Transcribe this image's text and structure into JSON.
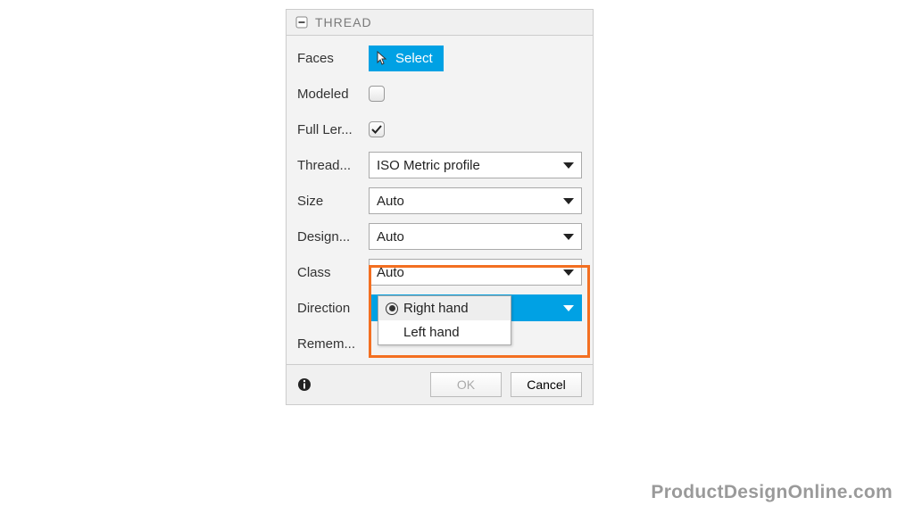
{
  "panel": {
    "title": "THREAD",
    "rows": {
      "faces": {
        "label": "Faces",
        "button": "Select"
      },
      "modeled": {
        "label": "Modeled",
        "checked": false
      },
      "full_length": {
        "label": "Full Ler...",
        "checked": true
      },
      "thread_type": {
        "label": "Thread...",
        "value": "ISO Metric profile"
      },
      "size": {
        "label": "Size",
        "value": "Auto"
      },
      "designation": {
        "label": "Design...",
        "value": "Auto"
      },
      "class": {
        "label": "Class",
        "value": "Auto"
      },
      "direction": {
        "label": "Direction",
        "value": "Right hand",
        "options": [
          "Right hand",
          "Left hand"
        ],
        "selected_index": 0
      },
      "remember": {
        "label": "Remem..."
      }
    },
    "footer": {
      "ok": "OK",
      "cancel": "Cancel"
    }
  },
  "watermark": "ProductDesignOnline.com"
}
